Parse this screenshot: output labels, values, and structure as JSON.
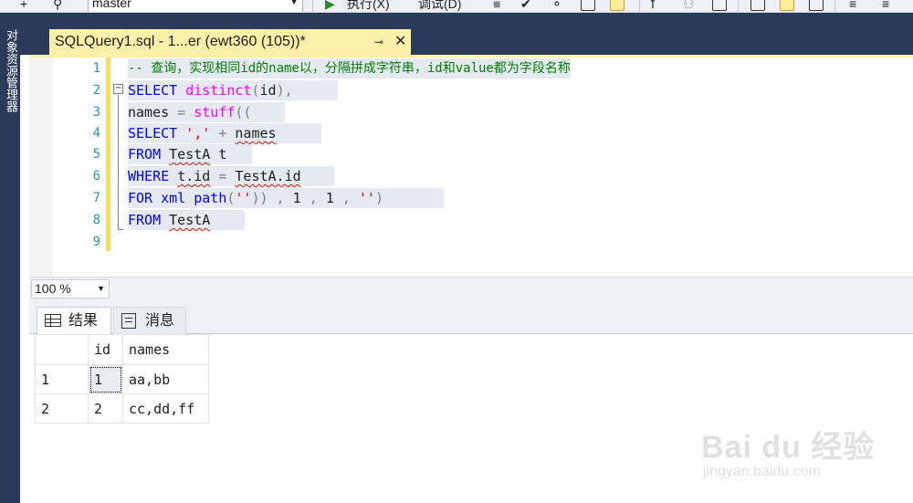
{
  "toolbar": {
    "database": "master",
    "execute_label": "执行(X)",
    "debug_label": "调试(D)"
  },
  "side_panel": {
    "label": "对象资源管理器"
  },
  "document_tab": {
    "title": "SQLQuery1.sql - 1...er (ewt360 (105))*",
    "pin_glyph": "⊸",
    "close_glyph": "✕"
  },
  "editor": {
    "line_numbers": [
      "1",
      "2",
      "3",
      "4",
      "5",
      "6",
      "7",
      "8",
      "9"
    ],
    "lines": [
      "-- 查询，实现相同id的name以，分隔拼成字符串，id和value都为字段名称",
      "SELECT distinct(id),",
      "names = stuff((",
      "SELECT ',' + names",
      "FROM TestA t",
      "WHERE t.id = TestA.id",
      "FOR xml path('')) , 1 , 1 , '')",
      "FROM TestA",
      ""
    ],
    "tokens": {
      "l2_kw": "SELECT",
      "l2_fn": "distinct",
      "l2_p1": "(",
      "l2_id": "id",
      "l2_p2": "),",
      "l3_a": "names ",
      "l3_eq": "=",
      "l3_fn": "stuff",
      "l3_p": "((",
      "l4_kw": "SELECT",
      "l4_st": "','",
      "l4_plus": "+",
      "l4_b": "names",
      "l5_kw": "FROM",
      "l5_b": "TestA",
      "l5_c": "t",
      "l6_kw": "WHERE",
      "l6_b": "t.id",
      "l6_eq": "=",
      "l6_c": "TestA.id",
      "l7_kw": "FOR",
      "l7_b": "xml",
      "l7_c": "path",
      "l7_p1": "(",
      "l7_st1": "''",
      "l7_p2": "))",
      "l7_c1": ",",
      "l7_n1": "1",
      "l7_c2": ",",
      "l7_n2": "1",
      "l7_c3": ",",
      "l7_st2": "''",
      "l7_p3": ")",
      "l8_kw": "FROM",
      "l8_b": "TestA"
    }
  },
  "zoom": {
    "value": "100 %"
  },
  "result_tabs": [
    {
      "label": "结果",
      "icon": "grid-icon",
      "selected": true
    },
    {
      "label": "消息",
      "icon": "messages-icon",
      "selected": false
    }
  ],
  "results": {
    "columns": [
      "id",
      "names"
    ],
    "rows": [
      {
        "row": "1",
        "id": "1",
        "names": "aa,bb"
      },
      {
        "row": "2",
        "id": "2",
        "names": "cc,dd,ff"
      }
    ]
  },
  "watermark": {
    "brand": "Bai du 经验",
    "url": "jingyan.baidu.com"
  },
  "colors": {
    "tab_active": "#fdf0a9",
    "panel_dark": "#2b3a58",
    "keyword": "#0000ff",
    "comment": "#008000",
    "string": "#ff0000",
    "function": "#ff00ff",
    "line_number": "#2b91af"
  }
}
